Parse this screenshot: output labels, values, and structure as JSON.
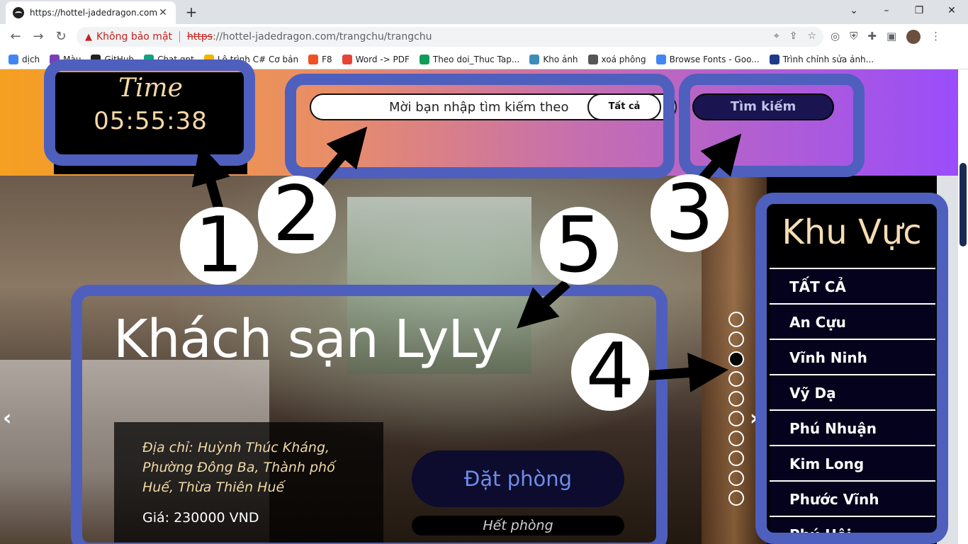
{
  "browser": {
    "tab_title": "https://hottel-jadedragon.com/tr",
    "tab_close": "✕",
    "new_tab": "+",
    "security_label": "Không bảo mật",
    "url_scheme": "https",
    "url_rest": "://hottel-jadedragon.com/trangchu/trangchu",
    "bookmarks": [
      {
        "label": "dịch",
        "color": "#4285f4"
      },
      {
        "label": "Màu",
        "color": "#7b3fb5"
      },
      {
        "label": "GitHub",
        "color": "#222222"
      },
      {
        "label": "Chat gpt",
        "color": "#10a37f"
      },
      {
        "label": "Lộ trình C# Cơ bản",
        "color": "#f4b400"
      },
      {
        "label": "F8",
        "color": "#f05123"
      },
      {
        "label": "Word -> PDF",
        "color": "#e94235"
      },
      {
        "label": "Theo doi_Thuc Tap...",
        "color": "#0f9d58"
      },
      {
        "label": "Kho ảnh",
        "color": "#3c8dbc"
      },
      {
        "label": "xoá phông",
        "color": "#555555"
      },
      {
        "label": "Browse Fonts - Goo...",
        "color": "#4285f4"
      },
      {
        "label": "Trình chỉnh sửa ảnh...",
        "color": "#1b3a8a"
      }
    ]
  },
  "header": {
    "clock_label": "Time",
    "clock_time": "05:55:38",
    "search_placeholder": "Mời bạn nhập tìm kiếm theo",
    "search_scope": "Tất cả",
    "search_button": "Tìm kiếm"
  },
  "hero": {
    "title": "Khách sạn LyLy",
    "address": "Địa chỉ: Huỳnh Thúc Kháng, Phường Đông Ba, Thành phố Huế, Thừa Thiên Huế",
    "price": "Giá: 230000 VND",
    "book_button": "Đặt phòng",
    "status": "Hết phòng",
    "prev": "‹",
    "next": "›",
    "slide_count": 10,
    "active_slide": 3
  },
  "sidebar": {
    "title": "Khu Vực",
    "items": [
      "TẤT CẢ",
      "An Cựu",
      "Vĩnh Ninh",
      "Vỹ Dạ",
      "Phú Nhuận",
      "Kim Long",
      "Phước Vĩnh",
      "Phú Hội"
    ]
  },
  "annotations": [
    "1",
    "2",
    "3",
    "4",
    "5"
  ],
  "colors": {
    "annotation_border": "#4f5fbe",
    "clock_text": "#f6d9a6",
    "book_text": "#6f8de8"
  }
}
